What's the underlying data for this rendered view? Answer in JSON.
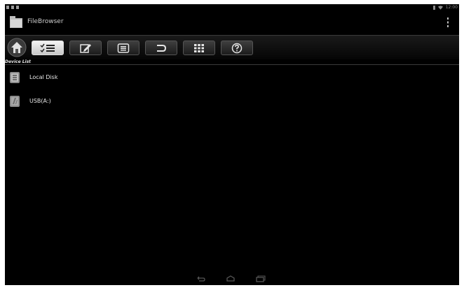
{
  "app": {
    "title": "FileBrowser"
  },
  "statusbar": {
    "time": "12:00"
  },
  "toolbar": {
    "buttons": [
      {
        "icon": "home-icon"
      },
      {
        "icon": "checklist-icon",
        "active": true
      },
      {
        "icon": "edit-icon"
      },
      {
        "icon": "list-icon"
      },
      {
        "icon": "back-arrow-icon"
      },
      {
        "icon": "grid-icon"
      },
      {
        "icon": "help-icon"
      }
    ]
  },
  "device_list": {
    "header": "Device List",
    "items": [
      {
        "label": "Local Disk",
        "icon": "local-disk-icon"
      },
      {
        "label": "USB(A:)",
        "icon": "usb-icon"
      }
    ]
  },
  "navbar": {
    "buttons": [
      "back-icon",
      "home-nav-icon",
      "recent-apps-icon"
    ]
  },
  "colors": {
    "background": "#000000",
    "text": "#e8e8e8",
    "active_button": "#e6e6e6"
  }
}
